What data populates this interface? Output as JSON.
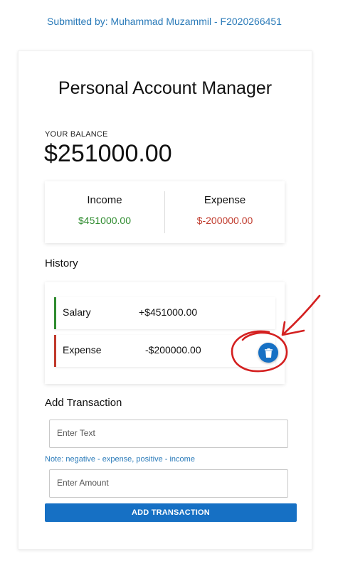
{
  "submitted_by": "Submitted by: Muhammad Muzammil - F2020266451",
  "app": {
    "title": "Personal Account Manager"
  },
  "balance": {
    "label": "YOUR BALANCE",
    "amount": "$251000.00"
  },
  "summary": {
    "income_label": "Income",
    "income_value": "$451000.00",
    "expense_label": "Expense",
    "expense_value": "$-200000.00"
  },
  "history": {
    "heading": "History",
    "items": [
      {
        "name": "Salary",
        "amount": "+$451000.00",
        "type": "income"
      },
      {
        "name": "Expense",
        "amount": "-$200000.00",
        "type": "expense"
      }
    ]
  },
  "add_transaction": {
    "heading": "Add Transaction",
    "text_placeholder": "Enter Text",
    "note": "Note: negative - expense, positive - income",
    "amount_placeholder": "Enter Amount",
    "button_label": "ADD TRANSACTION"
  },
  "colors": {
    "accent": "#1670c4",
    "income": "#2e8b2e",
    "expense": "#c0392b",
    "annotation": "#d42020"
  },
  "icons": {
    "delete": "trash-icon"
  }
}
